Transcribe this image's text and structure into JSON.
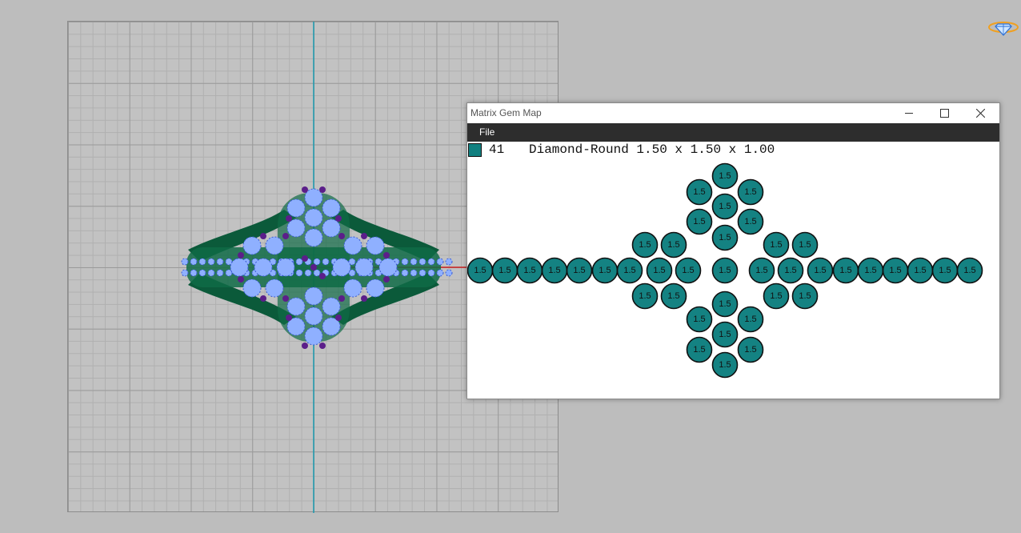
{
  "viewport": {
    "colors": {
      "metal": "#0b5a3a",
      "gem": "#8fb0ff",
      "accent_gem": "#5b1e8a",
      "axis_v": "#1a9ab0",
      "axis_h": "#cc2222"
    }
  },
  "logo": {
    "icon": "diamond-logo-icon",
    "color": "#f0a020"
  },
  "gem_window": {
    "title": "Matrix Gem Map",
    "controls": {
      "minimize": "—",
      "maximize": "☐",
      "close": "✕"
    },
    "menu": {
      "file": "File"
    },
    "gem": {
      "swatch_color": "#118080",
      "count": "41",
      "description": "Diamond-Round 1.50 x 1.50 x 1.00"
    },
    "gem_label": "1.5",
    "gem_color": "#148282"
  }
}
